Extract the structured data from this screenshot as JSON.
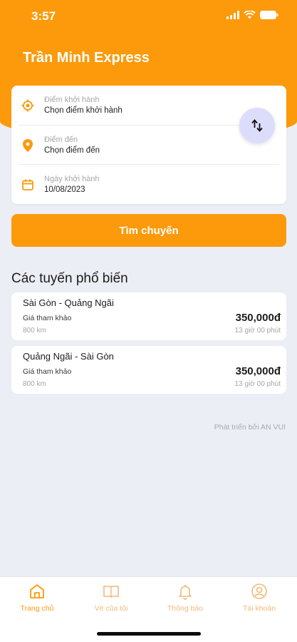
{
  "status_bar": {
    "time": "3:57"
  },
  "header": {
    "title": "Trần Minh Express"
  },
  "search_form": {
    "departure": {
      "label": "Điểm khởi hành",
      "value": "Chọn điểm khởi hành"
    },
    "destination": {
      "label": "Điểm đến",
      "value": "Chọn điểm đến"
    },
    "date": {
      "label": "Ngày khởi hành",
      "value": "10/08/2023"
    },
    "search_button": "Tìm chuyến"
  },
  "popular_routes": {
    "title": "Các tuyến phổ biến",
    "routes": [
      {
        "name": "Sài Gòn - Quảng Ngãi",
        "price_label": "Giá tham khảo",
        "price": "350,000đ",
        "distance": "800 km",
        "duration": "13 giờ 00 phút"
      },
      {
        "name": "Quảng Ngãi - Sài Gòn",
        "price_label": "Giá tham khảo",
        "price": "350,000đ",
        "distance": "800 km",
        "duration": "13 giờ 00 phút"
      }
    ]
  },
  "credit": "Phát triển bởi AN VUI",
  "tab_bar": {
    "items": [
      {
        "label": "Trang chủ",
        "icon": "home-icon",
        "active": true
      },
      {
        "label": "Vé của tôi",
        "icon": "ticket-book-icon",
        "active": false
      },
      {
        "label": "Thông báo",
        "icon": "bell-icon",
        "active": false
      },
      {
        "label": "Tài khoản",
        "icon": "user-icon",
        "active": false
      }
    ]
  },
  "colors": {
    "accent": "#fc9a0c",
    "background": "#eceef6",
    "swap_button": "#dcdcfb"
  }
}
